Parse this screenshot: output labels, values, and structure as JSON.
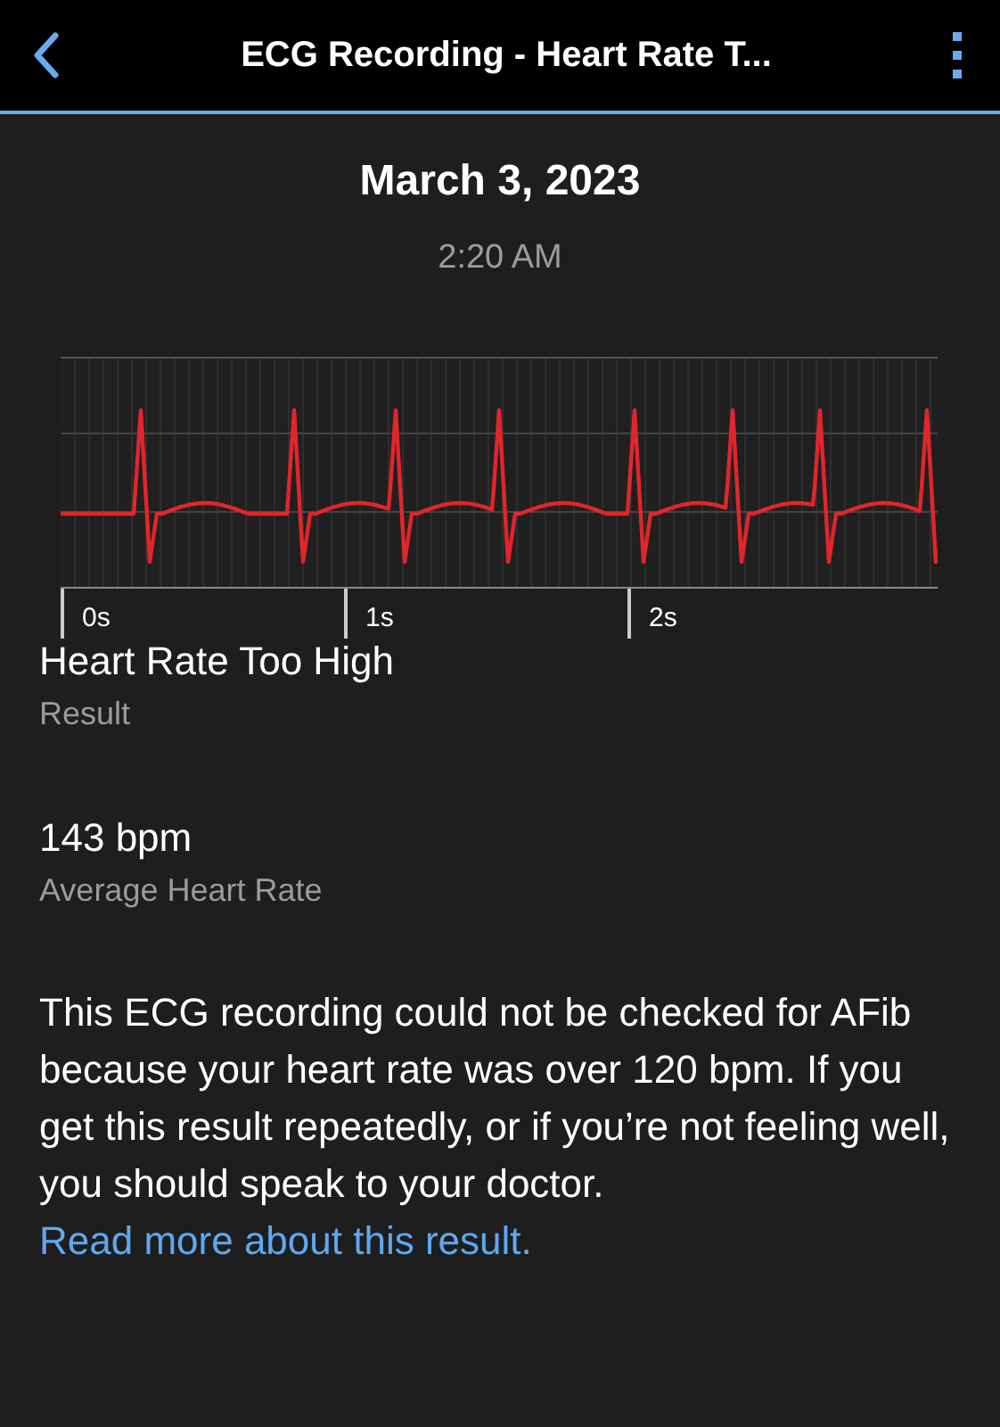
{
  "header": {
    "title": "ECG Recording - Heart Rate T..."
  },
  "recording": {
    "date": "March 3, 2023",
    "time": "2:20 AM"
  },
  "ecg": {
    "time_labels": [
      "0s",
      "1s",
      "2s"
    ]
  },
  "facts": [
    {
      "value": "Heart Rate Too High",
      "label": "Result"
    },
    {
      "value": "143 bpm",
      "label": "Average Heart Rate"
    }
  ],
  "note": {
    "text": "This ECG recording could not be checked for AFib because your heart rate was over 120 bpm. If you get this result repeatedly, or if you’re not feeling well, you should speak to your doctor.",
    "link": "Read more about this result."
  }
}
